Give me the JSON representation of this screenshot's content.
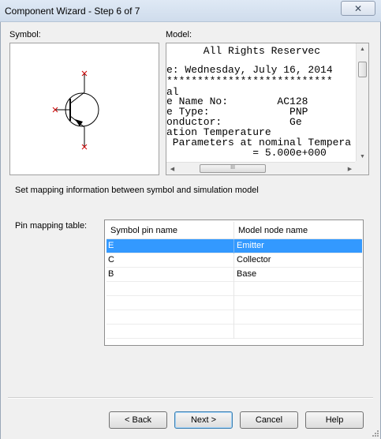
{
  "window": {
    "title": "Component Wizard - Step 6 of 7",
    "close_glyph": "✕"
  },
  "symbol": {
    "label": "Symbol:",
    "graphic": "pnp-transistor-symbol"
  },
  "model": {
    "label": "Model:",
    "lines": [
      "      All Rights Reservec",
      "e: Wednesday, July 16, 2014",
      "***************************",
      "al",
      "e Name No:        AC128",
      "e Type:             PNP",
      "onductor:           Ge",
      "ation Temperature",
      " Parameters at nominal Tempera",
      "              = 5.000e+000"
    ],
    "h_thumb_grip": "III"
  },
  "instruction": "Set mapping information between symbol and simulation model",
  "pin_mapping": {
    "label": "Pin mapping table:",
    "columns": [
      "Symbol pin name",
      "Model node name"
    ],
    "rows": [
      {
        "pin": "E",
        "node": "Emitter",
        "selected": true
      },
      {
        "pin": "C",
        "node": "Collector",
        "selected": false
      },
      {
        "pin": "B",
        "node": "Base",
        "selected": false
      }
    ]
  },
  "buttons": {
    "back": "< Back",
    "next": "Next >",
    "cancel": "Cancel",
    "help": "Help"
  },
  "colors": {
    "selection": "#3399ff",
    "pin_marker": "#cc0000"
  }
}
